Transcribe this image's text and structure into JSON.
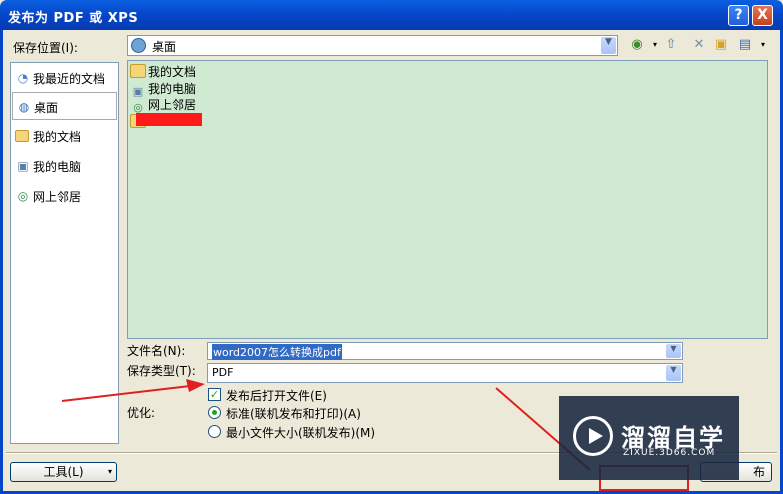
{
  "window": {
    "title": "发布为 PDF 或 XPS",
    "help_label": "?",
    "close_label": "X"
  },
  "lookin": {
    "label": "保存位置(I):",
    "value": "桌面"
  },
  "places": [
    {
      "label": "我最近的文档",
      "icon": "recent-docs-icon"
    },
    {
      "label": "桌面",
      "icon": "desktop-icon"
    },
    {
      "label": "我的文档",
      "icon": "my-documents-icon"
    },
    {
      "label": "我的电脑",
      "icon": "my-computer-icon"
    },
    {
      "label": "网上邻居",
      "icon": "network-places-icon"
    }
  ],
  "files": [
    {
      "name": "我的文档",
      "icon": "folder-icon"
    },
    {
      "name": "我的电脑",
      "icon": "computer-icon"
    },
    {
      "name": "网上邻居",
      "icon": "network-icon"
    }
  ],
  "filename": {
    "label": "文件名(N):",
    "value": "word2007怎么转换成pdf"
  },
  "savetype": {
    "label": "保存类型(T):",
    "value": "PDF"
  },
  "options": {
    "open_after_publish": "发布后打开文件(E)",
    "optimize_label": "优化:",
    "standard": "标准(联机发布和打印)(A)",
    "minimum": "最小文件大小(联机发布)(M)"
  },
  "buttons": {
    "tools": "工具(L)",
    "publish_partial": "布"
  },
  "watermark": {
    "title": "溜溜自学",
    "sub": "ZIXUE.3D66.COM"
  },
  "colors": {
    "titlebar": "#0646c9",
    "annotation_red": "#ff1a1a",
    "filelist_bg": "#cfead0"
  }
}
